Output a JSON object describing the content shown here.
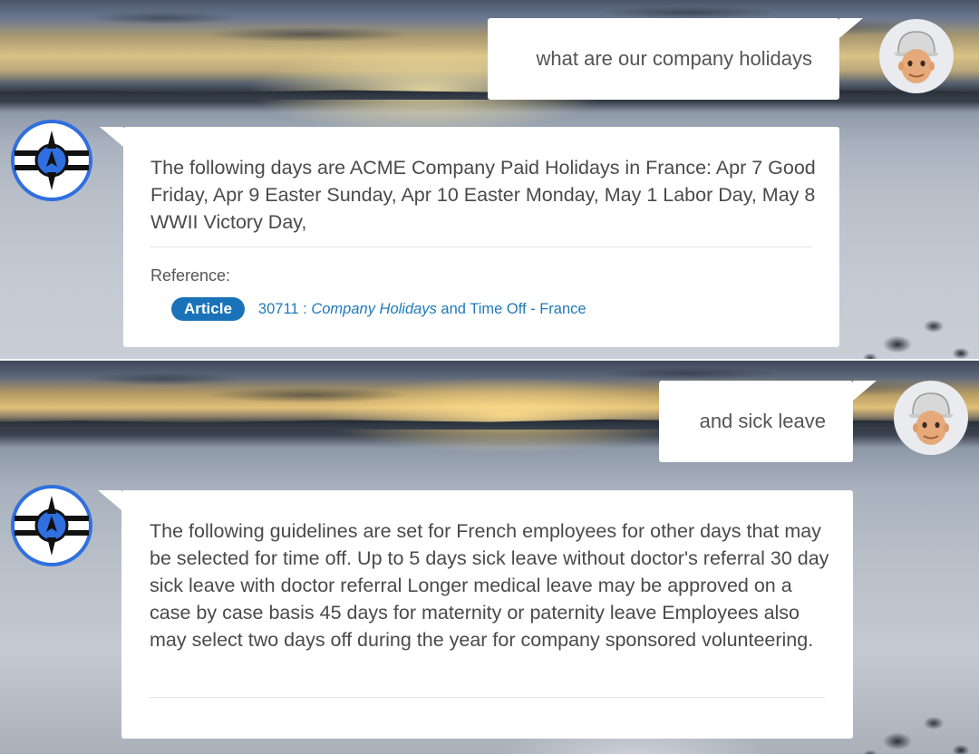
{
  "conversation": [
    {
      "user_message": "what are our company holidays",
      "bot_message": "The following days are ACME Company Paid Holidays in France: Apr 7 Good Friday, Apr 9 Easter Sunday, Apr 10 Easter Monday, May 1 Labor Day, May 8 WWII Victory Day,",
      "reference": {
        "label": "Reference:",
        "badge": "Article",
        "article_id": "30711 : ",
        "title_italic": "Company Holidays",
        "title_rest": " and Time Off - France"
      }
    },
    {
      "user_message": "and sick leave",
      "bot_message": "The following guidelines are set for French employees for other days that may be selected for time off. Up to 5 days sick leave without doctor's referral 30 day sick leave with doctor referral Longer medical leave may be approved on a case by case basis 45 days for maternity or paternity leave Employees also may select two days off during the year for company sponsored volunteering."
    }
  ],
  "icons": {
    "user_avatar": "user-avatar-icon",
    "bot_avatar": "bot-logo-icon"
  },
  "colors": {
    "badge": "#1a73b8",
    "link": "#1f79b8",
    "bot_ring": "#2f6fe0"
  }
}
